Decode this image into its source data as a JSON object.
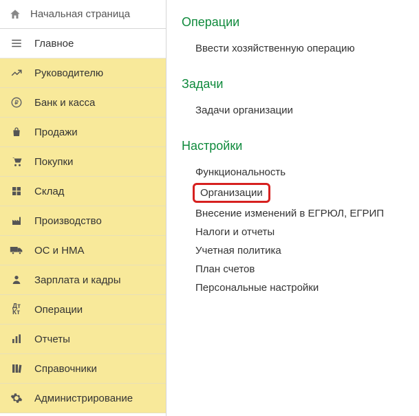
{
  "home": {
    "label": "Начальная страница"
  },
  "nav": [
    {
      "label": "Главное",
      "plain": true
    },
    {
      "label": "Руководителю"
    },
    {
      "label": "Банк и касса"
    },
    {
      "label": "Продажи"
    },
    {
      "label": "Покупки"
    },
    {
      "label": "Склад"
    },
    {
      "label": "Производство"
    },
    {
      "label": "ОС и НМА"
    },
    {
      "label": "Зарплата и кадры"
    },
    {
      "label": "Операции"
    },
    {
      "label": "Отчеты"
    },
    {
      "label": "Справочники"
    },
    {
      "label": "Администрирование"
    }
  ],
  "content": {
    "sections": [
      {
        "title": "Операции",
        "items": [
          {
            "label": "Ввести хозяйственную операцию"
          }
        ]
      },
      {
        "title": "Задачи",
        "items": [
          {
            "label": "Задачи организации"
          }
        ]
      },
      {
        "title": "Настройки",
        "items": [
          {
            "label": "Функциональность"
          },
          {
            "label": "Организации",
            "highlight": true
          },
          {
            "label": "Внесение изменений в ЕГРЮЛ, ЕГРИП"
          },
          {
            "label": "Налоги и отчеты"
          },
          {
            "label": "Учетная политика"
          },
          {
            "label": "План счетов"
          },
          {
            "label": "Персональные настройки"
          }
        ]
      }
    ]
  }
}
